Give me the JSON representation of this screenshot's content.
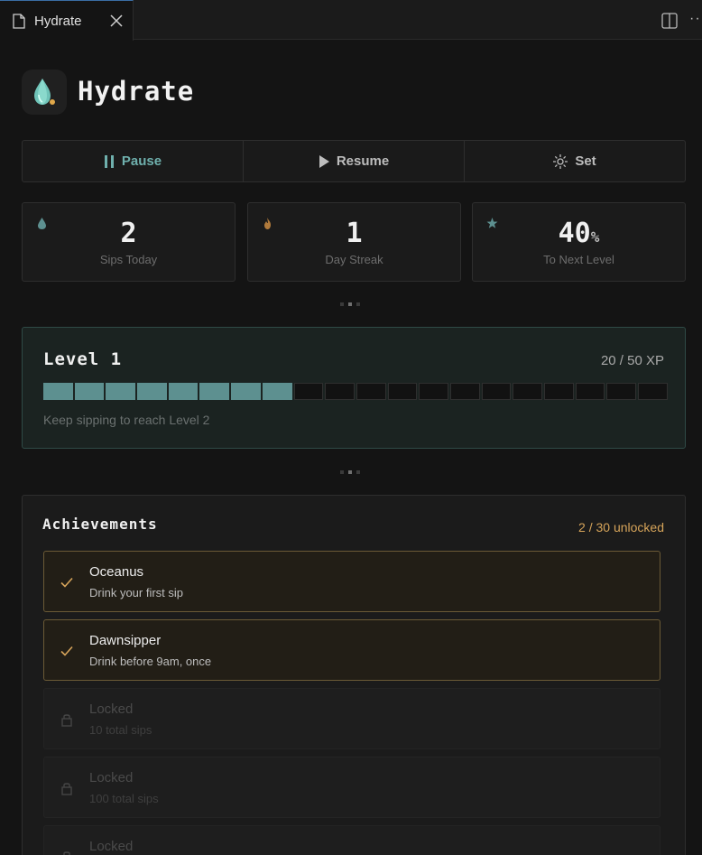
{
  "tab": {
    "label": "Hydrate"
  },
  "header": {
    "title": "Hydrate",
    "logo_icon": "water-drop-logo-icon"
  },
  "controls": [
    {
      "label": "Pause",
      "icon": "pause-icon",
      "active": true
    },
    {
      "label": "Resume",
      "icon": "play-icon",
      "active": false
    },
    {
      "label": "Set",
      "icon": "sun-gear-icon",
      "active": false
    }
  ],
  "stats": [
    {
      "value": "2",
      "unit": "",
      "label": "Sips Today",
      "icon": "drop-icon",
      "color": "#5d9090"
    },
    {
      "value": "1",
      "unit": "",
      "label": "Day Streak",
      "icon": "flame-icon",
      "color": "#b07a3c"
    },
    {
      "value": "40",
      "unit": "%",
      "label": "To Next Level",
      "icon": "star-icon",
      "color": "#5d9090"
    }
  ],
  "level": {
    "title": "Level 1",
    "xp": "20 / 50 XP",
    "progress": 0.4,
    "segments_total": 20,
    "hint": "Keep sipping to reach Level 2"
  },
  "achievements": {
    "title": "Achievements",
    "count": "2 / 30 unlocked",
    "items": [
      {
        "name": "Oceanus",
        "desc": "Drink your first sip",
        "unlocked": true
      },
      {
        "name": "Dawnsipper",
        "desc": "Drink before 9am, once",
        "unlocked": true
      },
      {
        "name": "Locked",
        "desc": "10 total sips",
        "unlocked": false
      },
      {
        "name": "Locked",
        "desc": "100 total sips",
        "unlocked": false
      },
      {
        "name": "Locked",
        "desc": "",
        "unlocked": false
      }
    ]
  },
  "colors": {
    "accent": "#5d9090",
    "gold": "#d6a45a"
  }
}
